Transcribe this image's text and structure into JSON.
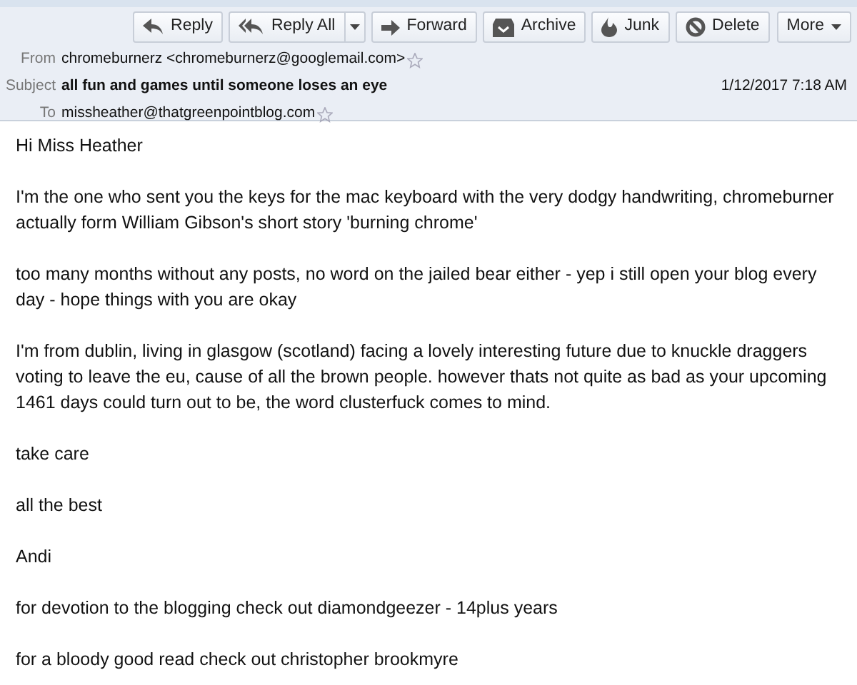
{
  "toolbar": [
    {
      "kind": "button",
      "label": "Reply"
    },
    {
      "kind": "split",
      "label": "Reply All"
    },
    {
      "kind": "button",
      "label": "Forward"
    },
    {
      "kind": "button",
      "label": "Archive"
    },
    {
      "kind": "button",
      "label": "Junk"
    },
    {
      "kind": "button",
      "label": "Delete"
    },
    {
      "kind": "menu",
      "label": "More"
    }
  ],
  "header": [
    {
      "label": "From",
      "value": "chromeburnerz <chromeburnerz@googlemail.com>",
      "starred": false
    },
    {
      "label": "Subject",
      "value": "all fun and games until someone loses an eye",
      "date": "1/12/2017 7:18 AM"
    },
    {
      "label": "To",
      "value": "missheather@thatgreenpointblog.com",
      "starred": false
    }
  ],
  "body": [
    "Hi Miss Heather",
    "I'm the one who sent you the keys for the mac keyboard with the very dodgy handwriting, chromeburner actually form William Gibson's short story 'burning chrome'",
    "too many months without any posts, no word on the jailed bear either - yep i still open your blog every day - hope things with you are okay",
    "I'm from dublin, living in glasgow (scotland) facing a lovely interesting future due to knuckle draggers voting to leave the eu, cause of all the brown people. however thats not quite as bad as your upcoming 1461 days could turn out to be, the word clusterfuck comes to mind.",
    "take care",
    "all the best",
    "Andi",
    "for devotion to the blogging check out diamondgeezer - 14plus years",
    "for a bloody good read check out christopher brookmyre"
  ]
}
